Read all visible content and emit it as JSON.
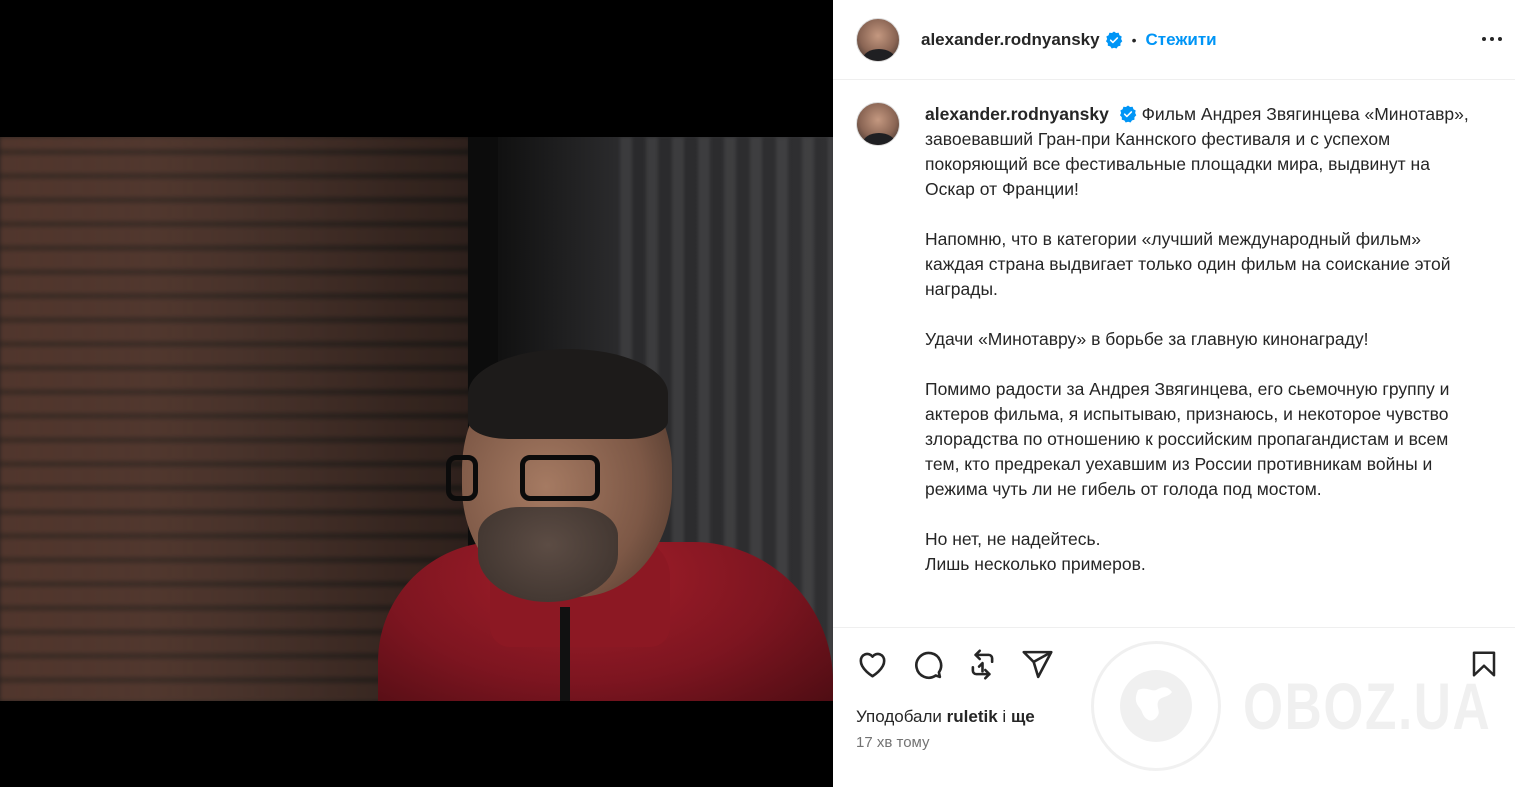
{
  "header": {
    "username": "alexander.rodnyansky",
    "separator": "•",
    "follow_label": "Стежити"
  },
  "caption": {
    "username": "alexander.rodnyansky",
    "paragraphs": [
      "Фильм Андрея Звягинцева «Минотавр», завоевавший Гран-при Каннского фестиваля и с успехом покоряющий все фестивальные площадки мира, выдвинут на Оскар от Франции!",
      "Напомню, что в категории «лучший международный фильм» каждая страна выдвигает только один фильм на соискание этой награды.",
      "Удачи «Минотавру» в борьбе за главную кинонаграду!",
      "Помимо радости за Андрея Звягинцева, его сьемочную группу и актеров фильма, я испытываю, признаюсь, и некоторое чувство злорадства по отношению к российским пропагандистам и всем тем, кто предрекал уехавшим из России противникам войны и режима чуть ли не гибель от голода под мостом.",
      "Но нет, не надейтесь.",
      "Лишь несколько примеров."
    ]
  },
  "likes": {
    "prefix": "Уподобали",
    "user": "ruletik",
    "middle": "і",
    "others": "ще"
  },
  "timestamp": "17 хв тому",
  "watermark": "OBOZ.UA",
  "icons": {
    "like": "heart-icon",
    "comment": "comment-icon",
    "repost": "repost-icon",
    "share": "send-icon",
    "save": "bookmark-icon",
    "verified": "verified-badge-icon",
    "more": "more-options-icon"
  },
  "colors": {
    "accent": "#0095f6",
    "text": "#262626",
    "muted": "#737373",
    "border": "#efefef"
  }
}
